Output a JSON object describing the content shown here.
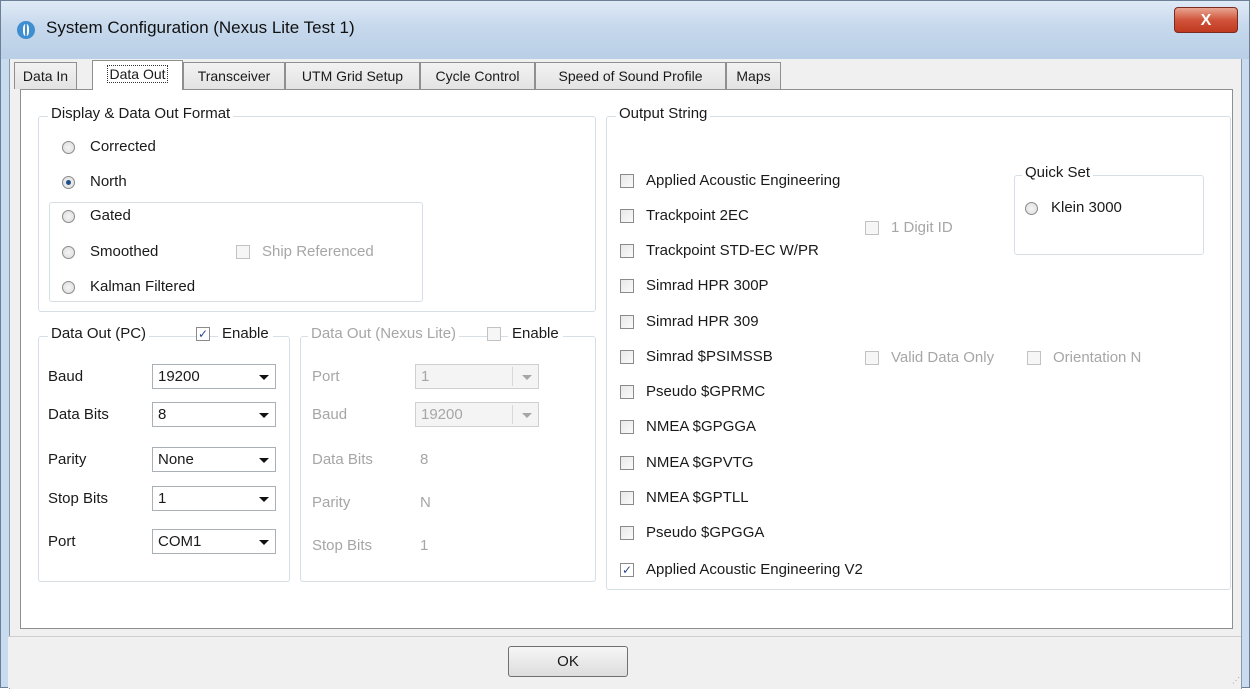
{
  "window": {
    "title": "System Configuration (Nexus Lite Test 1)",
    "close_label": "X",
    "ok_label": "OK"
  },
  "tabs": [
    "Data In",
    "Data Out",
    "Transceiver",
    "UTM Grid Setup",
    "Cycle Control",
    "Speed of Sound Profile",
    "Maps"
  ],
  "active_tab": "Data Out",
  "display_format": {
    "title": "Display & Data Out Format",
    "options": [
      "Corrected",
      "North",
      "Gated",
      "Smoothed",
      "Kalman Filtered"
    ],
    "selected": "North",
    "ship_referenced": "Ship Referenced"
  },
  "data_out_pc": {
    "title": "Data Out (PC)",
    "enable_label": "Enable",
    "enabled": true,
    "labels": {
      "baud": "Baud",
      "data_bits": "Data Bits",
      "parity": "Parity",
      "stop_bits": "Stop Bits",
      "port": "Port"
    },
    "values": {
      "baud": "19200",
      "data_bits": "8",
      "parity": "None",
      "stop_bits": "1",
      "port": "COM1"
    }
  },
  "data_out_nexus": {
    "title": "Data Out (Nexus Lite)",
    "enable_label": "Enable",
    "enabled": false,
    "labels": {
      "port": "Port",
      "baud": "Baud",
      "data_bits": "Data Bits",
      "parity": "Parity",
      "stop_bits": "Stop Bits"
    },
    "values": {
      "port": "1",
      "baud": "19200",
      "data_bits": "8",
      "parity": "N",
      "stop_bits": "1"
    }
  },
  "output_string": {
    "title": "Output String",
    "items": [
      {
        "label": "Applied Acoustic Engineering",
        "checked": false
      },
      {
        "label": "Trackpoint 2EC",
        "checked": false
      },
      {
        "label": "Trackpoint STD-EC W/PR",
        "checked": false
      },
      {
        "label": "Simrad HPR 300P",
        "checked": false
      },
      {
        "label": "Simrad HPR 309",
        "checked": false
      },
      {
        "label": "Simrad $PSIMSSB",
        "checked": false
      },
      {
        "label": "Pseudo $GPRMC",
        "checked": false
      },
      {
        "label": "NMEA $GPGGA",
        "checked": false
      },
      {
        "label": "NMEA $GPVTG",
        "checked": false
      },
      {
        "label": "NMEA $GPTLL",
        "checked": false
      },
      {
        "label": "Pseudo $GPGGA",
        "checked": false
      },
      {
        "label": "Applied Acoustic Engineering V2",
        "checked": true
      }
    ],
    "one_digit_id": "1 Digit ID",
    "valid_data_only": "Valid Data Only",
    "orientation_n": "Orientation N"
  },
  "quick_set": {
    "title": "Quick Set",
    "option": "Klein 3000"
  },
  "colors": {
    "title_bar": "#c6d8ec",
    "close_button": "#c94a31",
    "disabled_text": "#a6a6a6"
  }
}
